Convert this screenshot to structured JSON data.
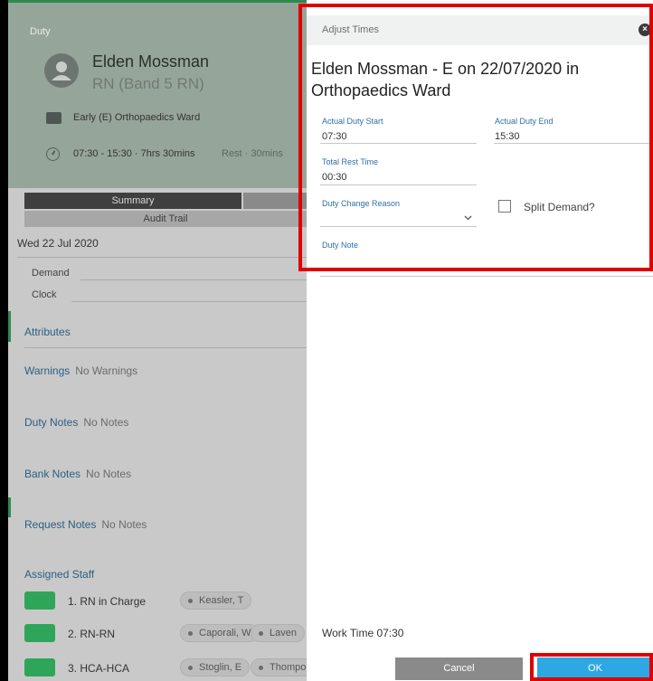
{
  "duty_panel": {
    "header_label": "Duty",
    "staff_name": "Elden Mossman",
    "staff_grade": "RN (Band 5 RN)",
    "shift": "Early (E) Orthopaedics Ward",
    "time_main": "07:30 - 15:30 · 7hrs 30mins",
    "time_rest": "Rest · 30mins",
    "tabs": {
      "summary": "Summary",
      "audit_trail": "Audit Trail"
    },
    "date": "Wed 22 Jul 2020",
    "demand_label": "Demand",
    "clock_label": "Clock",
    "sections": {
      "attributes": "Attributes",
      "warnings": "Warnings",
      "warnings_value": "No Warnings",
      "duty_notes": "Duty Notes",
      "duty_notes_value": "No Notes",
      "bank_notes": "Bank Notes",
      "bank_notes_value": "No Notes",
      "request_notes": "Request Notes",
      "request_notes_value": "No Notes",
      "assigned_staff": "Assigned Staff"
    },
    "assigned": [
      {
        "role": "1. RN in Charge",
        "staff": [
          "Keasler, T"
        ]
      },
      {
        "role": "2. RN-RN",
        "staff": [
          "Caporali, W",
          "Laven"
        ]
      },
      {
        "role": "3. HCA-HCA",
        "staff": [
          "Stoglin, E",
          "Thompo"
        ]
      }
    ]
  },
  "modal": {
    "title": "Adjust Times",
    "heading": "Elden Mossman - E on 22/07/2020 in Orthopaedics Ward",
    "actual_start_label": "Actual Duty Start",
    "actual_start_value": "07:30",
    "actual_end_label": "Actual Duty End",
    "actual_end_value": "15:30",
    "rest_label": "Total Rest Time",
    "rest_value": "00:30",
    "reason_label": "Duty Change Reason",
    "reason_value": "",
    "split_demand_label": "Split Demand?",
    "duty_note_label": "Duty Note",
    "work_time": "Work Time 07:30",
    "cancel_label": "Cancel",
    "ok_label": "OK"
  },
  "colors": {
    "accent": "#2ea8e2",
    "highlight": "#e00000",
    "staff_green": "#2fa55a"
  }
}
